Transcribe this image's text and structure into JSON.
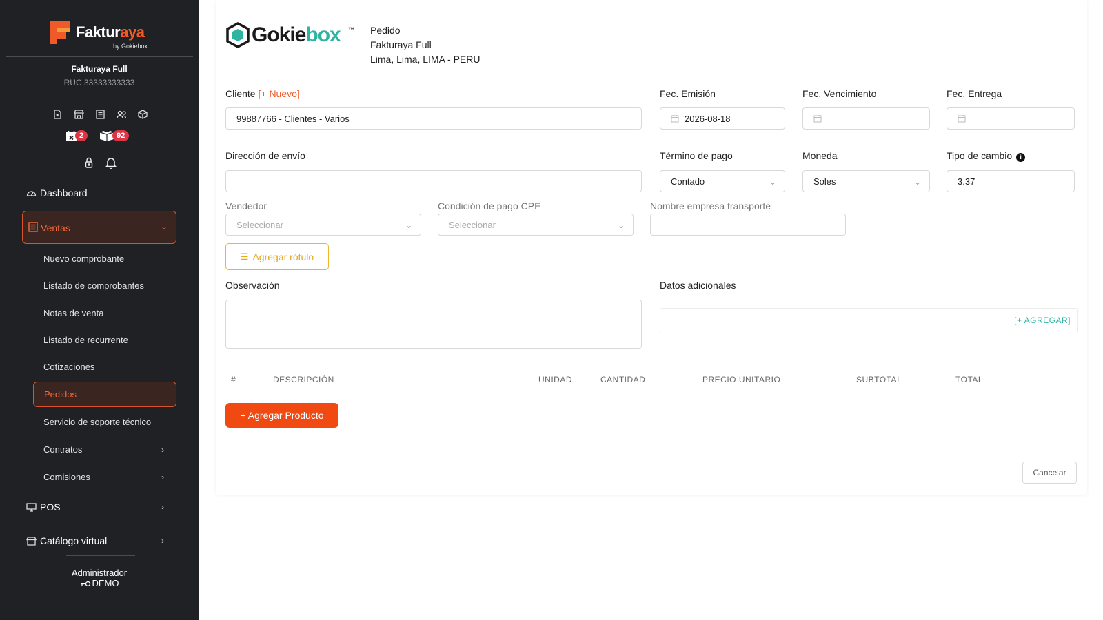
{
  "sidebar": {
    "brand": {
      "word_main": "Faktur",
      "word_accent": "aya",
      "byline": "by Gokiebox"
    },
    "company": {
      "name": "Fakturaya Full",
      "ruc": "RUC 33333333333"
    },
    "quick_icons": [
      "file-plus-icon",
      "store-icon",
      "list-icon",
      "users-icon",
      "box-icon"
    ],
    "badges": [
      {
        "icon": "calendar-x-icon",
        "count": "2"
      },
      {
        "icon": "boxes-icon",
        "count": "92"
      }
    ],
    "tool_icons": [
      "lock-icon",
      "bell-icon"
    ],
    "nav": {
      "dashboard": "Dashboard",
      "ventas": "Ventas",
      "sub": [
        "Nuevo comprobante",
        "Listado de comprobantes",
        "Notas de venta",
        "Listado de recurrente",
        "Cotizaciones",
        "Pedidos",
        "Servicio de soporte técnico",
        "Contratos",
        "Comisiones"
      ],
      "pos": "POS",
      "catalogo": "Catálogo virtual"
    },
    "user": {
      "role": "Administrador",
      "name": "DEMO"
    }
  },
  "header": {
    "logo": {
      "part1": "Gokie",
      "part2": "box",
      "tm": "™"
    },
    "doc_type": "Pedido",
    "company": "Fakturaya Full",
    "location": "Lima, Lima, LIMA - PERU"
  },
  "form": {
    "cliente_label": "Cliente",
    "cliente_new": "[+ Nuevo]",
    "cliente_value": "99887766 - Clientes - Varios",
    "fec_emision_label": "Fec. Emisión",
    "fec_emision_value": "2026-08-18",
    "fec_vencimiento_label": "Fec. Vencimiento",
    "fec_entrega_label": "Fec. Entrega",
    "direccion_label": "Dirección de envío",
    "termino_label": "Término de pago",
    "termino_value": "Contado",
    "moneda_label": "Moneda",
    "moneda_value": "Soles",
    "tipo_cambio_label": "Tipo de cambio",
    "tipo_cambio_value": "3.37",
    "vendedor_label": "Vendedor",
    "vendedor_placeholder": "Seleccionar",
    "condicion_label": "Condición de pago CPE",
    "condicion_placeholder": "Seleccionar",
    "transporte_label": "Nombre empresa transporte",
    "rotulo_button": "Agregar rótulo",
    "observacion_label": "Observación",
    "datos_label": "Datos adicionales",
    "datos_add": "[+ AGREGAR]"
  },
  "table": {
    "columns": [
      "#",
      "DESCRIPCIÓN",
      "UNIDAD",
      "CANTIDAD",
      "PRECIO UNITARIO",
      "SUBTOTAL",
      "TOTAL"
    ]
  },
  "actions": {
    "add_product": "+ Agregar Producto",
    "cancel": "Cancelar"
  },
  "colors": {
    "accent": "#f05a28",
    "teal": "#2fb3a3",
    "sidebar": "#1f2125",
    "warning": "#f0b429"
  }
}
